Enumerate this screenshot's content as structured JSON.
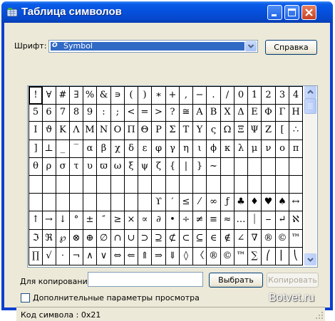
{
  "window": {
    "title": "Таблица символов"
  },
  "font": {
    "label": "Шрифт:",
    "selected": "Symbol",
    "type_badge": "O"
  },
  "buttons": {
    "help": "Справка",
    "select": "Выбрать",
    "copy": "Копировать"
  },
  "copy_field": {
    "label": "Для копирования:",
    "value": ""
  },
  "advanced": {
    "label": "Дополнительные параметры просмотра",
    "checked": false
  },
  "status": {
    "text": "Код символа : 0x21"
  },
  "watermark": "Botvet.ru",
  "grid": {
    "selected_index": 0,
    "rows": [
      [
        "!",
        "∀",
        "#",
        "∃",
        "%",
        "&",
        "∍",
        "(",
        ")",
        "∗",
        "+",
        ",",
        "−",
        ".",
        "/",
        "0",
        "1",
        "2",
        "3",
        "4"
      ],
      [
        "5",
        "6",
        "7",
        "8",
        "9",
        ":",
        ";",
        "<",
        "=",
        ">",
        "?",
        "≅",
        "Α",
        "Β",
        "Χ",
        "Δ",
        "Ε",
        "Φ",
        "Γ",
        "Η"
      ],
      [
        "Ι",
        "ϑ",
        "Κ",
        "Λ",
        "Μ",
        "Ν",
        "Ο",
        "Π",
        "Θ",
        "Ρ",
        "Σ",
        "Τ",
        "Υ",
        "ς",
        "Ω",
        "Ξ",
        "Ψ",
        "Ζ",
        "[",
        "∴"
      ],
      [
        "]",
        "⊥",
        "_",
        "‾",
        "α",
        "β",
        "χ",
        "δ",
        "ε",
        "φ",
        "γ",
        "η",
        "ι",
        "ϕ",
        "κ",
        "λ",
        "μ",
        "ν",
        "ο",
        "π"
      ],
      [
        "θ",
        "ρ",
        "σ",
        "τ",
        "υ",
        "ϖ",
        "ω",
        "ξ",
        "ψ",
        "ζ",
        "{",
        "|",
        "}",
        "~",
        "",
        "",
        "",
        "",
        "",
        ""
      ],
      [
        "",
        "",
        "",
        "",
        "",
        "",
        "",
        "",
        "",
        "",
        "",
        "",
        "",
        "",
        "",
        "",
        "",
        "",
        "",
        ""
      ],
      [
        "",
        "",
        "",
        "",
        "",
        "",
        "",
        "",
        "",
        "ϒ",
        "′",
        "≤",
        "⁄",
        "∞",
        "ƒ",
        "♣",
        "♦",
        "♥",
        "♠",
        "↔"
      ],
      [
        "↑",
        "→",
        "↓",
        "°",
        "±",
        "″",
        "≥",
        "×",
        "∝",
        "∂",
        "•",
        "÷",
        "≠",
        "≡",
        "≈",
        "…",
        "⏐",
        "⎯",
        "↵",
        "ℵ"
      ],
      [
        "ℑ",
        "ℜ",
        "℘",
        "⊗",
        "⊕",
        "∅",
        "∩",
        "∪",
        "⊃",
        "⊇",
        "⊄",
        "⊂",
        "⊆",
        "∈",
        "∉",
        "∠",
        "∇",
        "®",
        "©",
        "™"
      ],
      [
        "∏",
        "√",
        "⋅",
        "¬",
        "∧",
        "∨",
        "⇔",
        "⇐",
        "⇑",
        "⇒",
        "⇓",
        "◊",
        "〈",
        "®",
        "©",
        "™",
        "∑",
        "⎛",
        "⎜",
        "⎝"
      ]
    ]
  }
}
